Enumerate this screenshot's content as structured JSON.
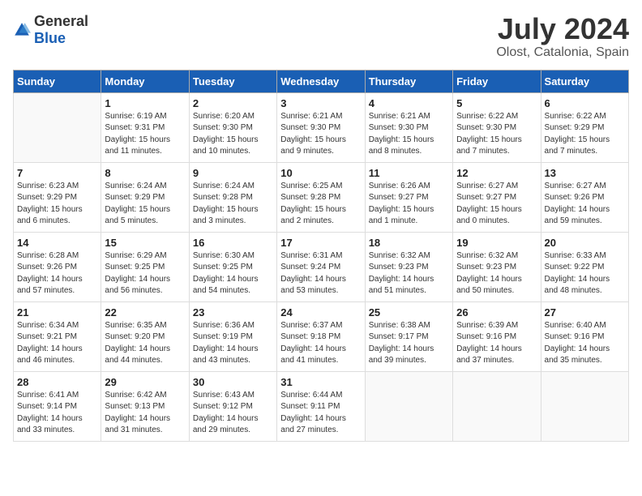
{
  "logo": {
    "general": "General",
    "blue": "Blue"
  },
  "header": {
    "month": "July 2024",
    "location": "Olost, Catalonia, Spain"
  },
  "weekdays": [
    "Sunday",
    "Monday",
    "Tuesday",
    "Wednesday",
    "Thursday",
    "Friday",
    "Saturday"
  ],
  "weeks": [
    [
      {
        "day": "",
        "info": ""
      },
      {
        "day": "1",
        "info": "Sunrise: 6:19 AM\nSunset: 9:31 PM\nDaylight: 15 hours\nand 11 minutes."
      },
      {
        "day": "2",
        "info": "Sunrise: 6:20 AM\nSunset: 9:30 PM\nDaylight: 15 hours\nand 10 minutes."
      },
      {
        "day": "3",
        "info": "Sunrise: 6:21 AM\nSunset: 9:30 PM\nDaylight: 15 hours\nand 9 minutes."
      },
      {
        "day": "4",
        "info": "Sunrise: 6:21 AM\nSunset: 9:30 PM\nDaylight: 15 hours\nand 8 minutes."
      },
      {
        "day": "5",
        "info": "Sunrise: 6:22 AM\nSunset: 9:30 PM\nDaylight: 15 hours\nand 7 minutes."
      },
      {
        "day": "6",
        "info": "Sunrise: 6:22 AM\nSunset: 9:29 PM\nDaylight: 15 hours\nand 7 minutes."
      }
    ],
    [
      {
        "day": "7",
        "info": "Sunrise: 6:23 AM\nSunset: 9:29 PM\nDaylight: 15 hours\nand 6 minutes."
      },
      {
        "day": "8",
        "info": "Sunrise: 6:24 AM\nSunset: 9:29 PM\nDaylight: 15 hours\nand 5 minutes."
      },
      {
        "day": "9",
        "info": "Sunrise: 6:24 AM\nSunset: 9:28 PM\nDaylight: 15 hours\nand 3 minutes."
      },
      {
        "day": "10",
        "info": "Sunrise: 6:25 AM\nSunset: 9:28 PM\nDaylight: 15 hours\nand 2 minutes."
      },
      {
        "day": "11",
        "info": "Sunrise: 6:26 AM\nSunset: 9:27 PM\nDaylight: 15 hours\nand 1 minute."
      },
      {
        "day": "12",
        "info": "Sunrise: 6:27 AM\nSunset: 9:27 PM\nDaylight: 15 hours\nand 0 minutes."
      },
      {
        "day": "13",
        "info": "Sunrise: 6:27 AM\nSunset: 9:26 PM\nDaylight: 14 hours\nand 59 minutes."
      }
    ],
    [
      {
        "day": "14",
        "info": "Sunrise: 6:28 AM\nSunset: 9:26 PM\nDaylight: 14 hours\nand 57 minutes."
      },
      {
        "day": "15",
        "info": "Sunrise: 6:29 AM\nSunset: 9:25 PM\nDaylight: 14 hours\nand 56 minutes."
      },
      {
        "day": "16",
        "info": "Sunrise: 6:30 AM\nSunset: 9:25 PM\nDaylight: 14 hours\nand 54 minutes."
      },
      {
        "day": "17",
        "info": "Sunrise: 6:31 AM\nSunset: 9:24 PM\nDaylight: 14 hours\nand 53 minutes."
      },
      {
        "day": "18",
        "info": "Sunrise: 6:32 AM\nSunset: 9:23 PM\nDaylight: 14 hours\nand 51 minutes."
      },
      {
        "day": "19",
        "info": "Sunrise: 6:32 AM\nSunset: 9:23 PM\nDaylight: 14 hours\nand 50 minutes."
      },
      {
        "day": "20",
        "info": "Sunrise: 6:33 AM\nSunset: 9:22 PM\nDaylight: 14 hours\nand 48 minutes."
      }
    ],
    [
      {
        "day": "21",
        "info": "Sunrise: 6:34 AM\nSunset: 9:21 PM\nDaylight: 14 hours\nand 46 minutes."
      },
      {
        "day": "22",
        "info": "Sunrise: 6:35 AM\nSunset: 9:20 PM\nDaylight: 14 hours\nand 44 minutes."
      },
      {
        "day": "23",
        "info": "Sunrise: 6:36 AM\nSunset: 9:19 PM\nDaylight: 14 hours\nand 43 minutes."
      },
      {
        "day": "24",
        "info": "Sunrise: 6:37 AM\nSunset: 9:18 PM\nDaylight: 14 hours\nand 41 minutes."
      },
      {
        "day": "25",
        "info": "Sunrise: 6:38 AM\nSunset: 9:17 PM\nDaylight: 14 hours\nand 39 minutes."
      },
      {
        "day": "26",
        "info": "Sunrise: 6:39 AM\nSunset: 9:16 PM\nDaylight: 14 hours\nand 37 minutes."
      },
      {
        "day": "27",
        "info": "Sunrise: 6:40 AM\nSunset: 9:16 PM\nDaylight: 14 hours\nand 35 minutes."
      }
    ],
    [
      {
        "day": "28",
        "info": "Sunrise: 6:41 AM\nSunset: 9:14 PM\nDaylight: 14 hours\nand 33 minutes."
      },
      {
        "day": "29",
        "info": "Sunrise: 6:42 AM\nSunset: 9:13 PM\nDaylight: 14 hours\nand 31 minutes."
      },
      {
        "day": "30",
        "info": "Sunrise: 6:43 AM\nSunset: 9:12 PM\nDaylight: 14 hours\nand 29 minutes."
      },
      {
        "day": "31",
        "info": "Sunrise: 6:44 AM\nSunset: 9:11 PM\nDaylight: 14 hours\nand 27 minutes."
      },
      {
        "day": "",
        "info": ""
      },
      {
        "day": "",
        "info": ""
      },
      {
        "day": "",
        "info": ""
      }
    ]
  ]
}
